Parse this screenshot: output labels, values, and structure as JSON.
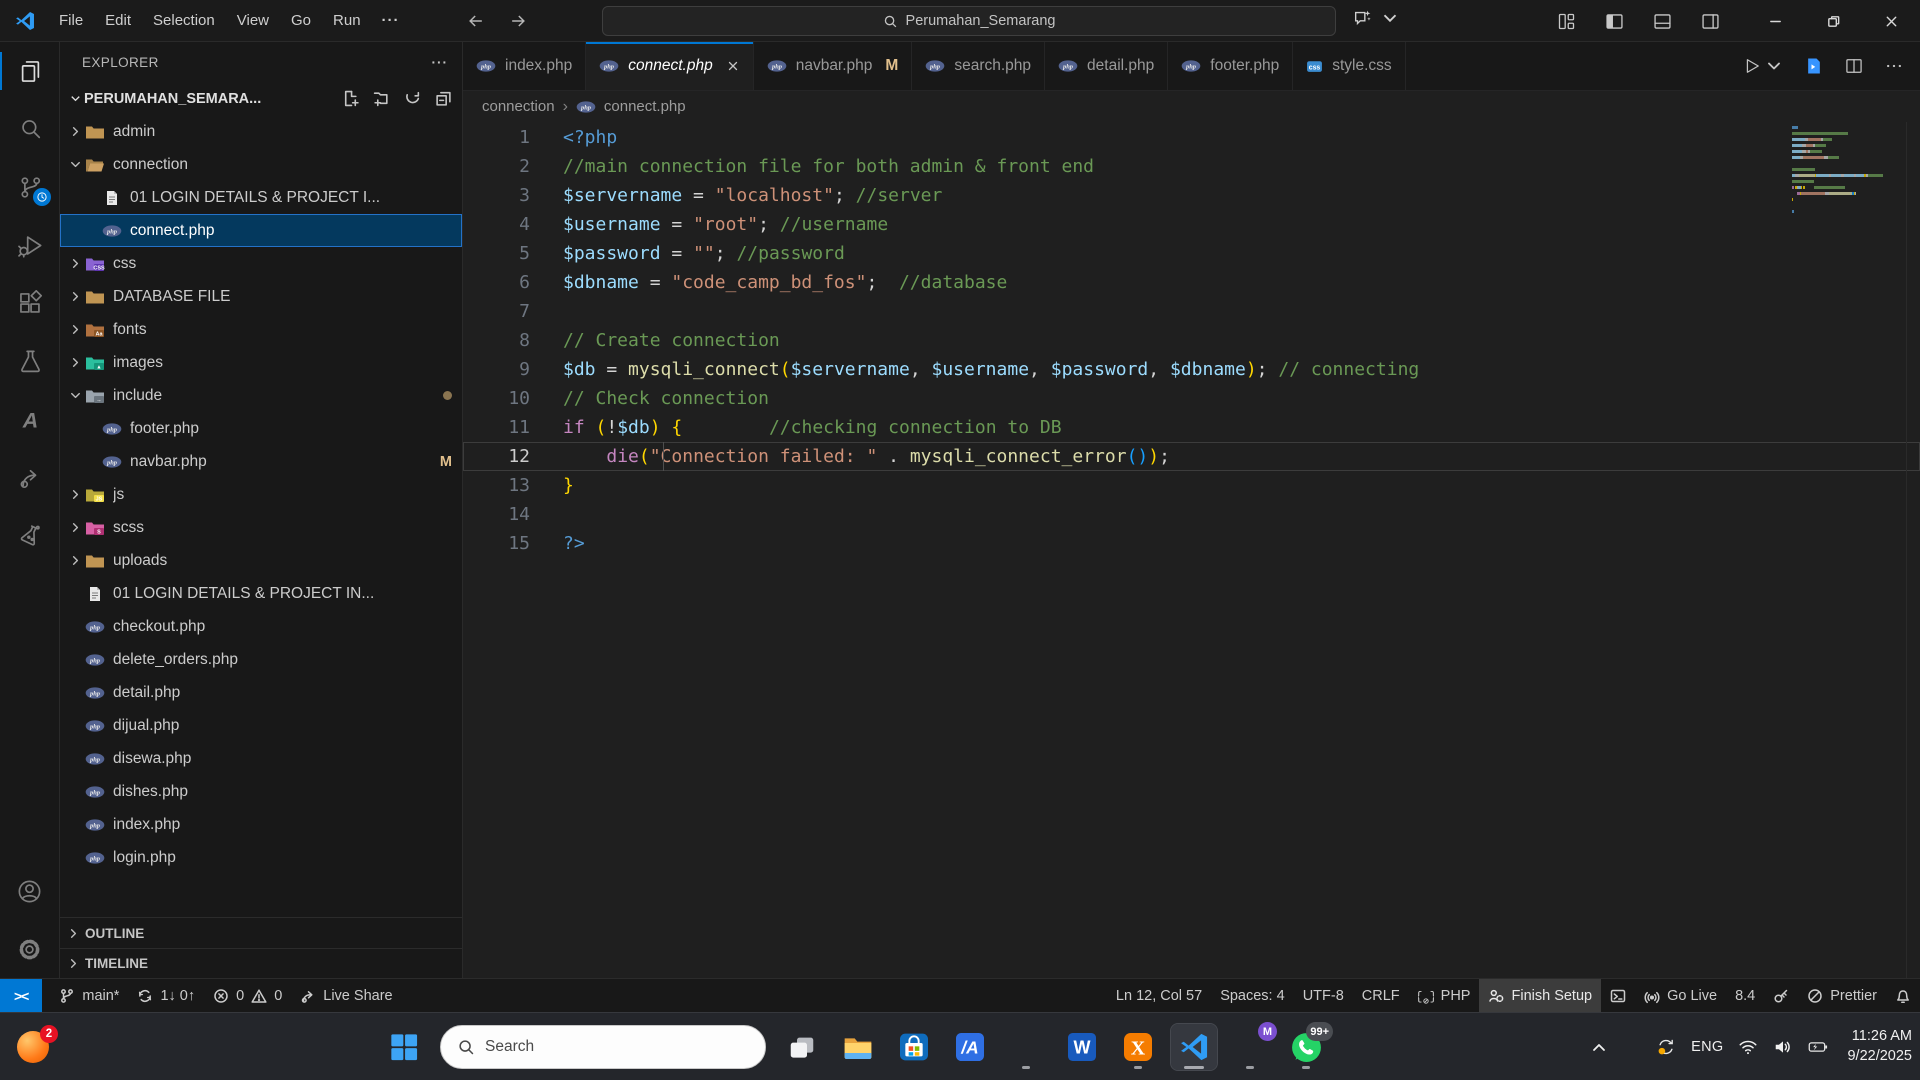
{
  "title_bar": {
    "menus": [
      "File",
      "Edit",
      "Selection",
      "View",
      "Go",
      "Run"
    ],
    "menu_more": "···",
    "search_value": "Perumahan_Semarang",
    "layout_icons": [
      "customize-layout",
      "toggle-primary-sidebar",
      "toggle-panel",
      "toggle-secondary-sidebar"
    ],
    "window_controls": [
      "minimize",
      "maximize",
      "close"
    ]
  },
  "activity_bar": {
    "top": [
      {
        "name": "explorer",
        "active": true
      },
      {
        "name": "search"
      },
      {
        "name": "source-control",
        "badge": "clock"
      },
      {
        "name": "run-debug"
      },
      {
        "name": "extensions"
      },
      {
        "name": "testing"
      },
      {
        "name": "azure"
      },
      {
        "name": "live-share"
      },
      {
        "name": "lab"
      }
    ],
    "bottom": [
      {
        "name": "accounts"
      },
      {
        "name": "settings"
      }
    ]
  },
  "explorer": {
    "title": "EXPLORER",
    "more": "···",
    "project": "PERUMAHAN_SEMARA...",
    "actions": [
      "new-file",
      "new-folder",
      "refresh",
      "collapse-all"
    ],
    "items": [
      {
        "label": "admin",
        "icon": "folder",
        "chev": "right",
        "indent": 1
      },
      {
        "label": "connection",
        "icon": "folder-open",
        "chev": "down",
        "indent": 1
      },
      {
        "label": "01 LOGIN DETAILS & PROJECT I...",
        "icon": "doc",
        "indent": 2
      },
      {
        "label": "connect.php",
        "icon": "php",
        "indent": 2,
        "selected": true
      },
      {
        "label": "css",
        "icon": "folder-css",
        "chev": "right",
        "indent": 1
      },
      {
        "label": "DATABASE FILE",
        "icon": "folder",
        "chev": "right",
        "indent": 1
      },
      {
        "label": "fonts",
        "icon": "folder-fonts",
        "chev": "right",
        "indent": 1
      },
      {
        "label": "images",
        "icon": "folder-images",
        "chev": "right",
        "indent": 1
      },
      {
        "label": "include",
        "icon": "folder-include",
        "chev": "down",
        "indent": 1,
        "dot": true
      },
      {
        "label": "footer.php",
        "icon": "php",
        "indent": 2
      },
      {
        "label": "navbar.php",
        "icon": "php",
        "indent": 2,
        "badge": "M"
      },
      {
        "label": "js",
        "icon": "folder-js",
        "chev": "right",
        "indent": 1
      },
      {
        "label": "scss",
        "icon": "folder-scss",
        "chev": "right",
        "indent": 1
      },
      {
        "label": "uploads",
        "icon": "folder",
        "chev": "right",
        "indent": 1
      },
      {
        "label": "01 LOGIN DETAILS & PROJECT IN...",
        "icon": "doc",
        "indent": 1
      },
      {
        "label": "checkout.php",
        "icon": "php",
        "indent": 1
      },
      {
        "label": "delete_orders.php",
        "icon": "php",
        "indent": 1
      },
      {
        "label": "detail.php",
        "icon": "php",
        "indent": 1
      },
      {
        "label": "dijual.php",
        "icon": "php",
        "indent": 1
      },
      {
        "label": "disewa.php",
        "icon": "php",
        "indent": 1
      },
      {
        "label": "dishes.php",
        "icon": "php",
        "indent": 1
      },
      {
        "label": "index.php",
        "icon": "php",
        "indent": 1
      },
      {
        "label": "login.php",
        "icon": "php",
        "indent": 1
      }
    ],
    "sections": [
      "OUTLINE",
      "TIMELINE"
    ]
  },
  "tabs": {
    "items": [
      {
        "label": "index.php",
        "icon": "php"
      },
      {
        "label": "connect.php",
        "icon": "php",
        "active": true,
        "closeable": true
      },
      {
        "label": "navbar.php",
        "icon": "php",
        "badge": "M"
      },
      {
        "label": "search.php",
        "icon": "php"
      },
      {
        "label": "detail.php",
        "icon": "php"
      },
      {
        "label": "footer.php",
        "icon": "php"
      },
      {
        "label": "style.css",
        "icon": "css"
      }
    ],
    "actions": [
      "run",
      "preview-browser",
      "split-editor",
      "more-actions"
    ]
  },
  "breadcrumb": {
    "parts": [
      "connection",
      "connect.php"
    ]
  },
  "editor": {
    "lines": [
      {
        "n": "1",
        "t": [
          [
            "<?php",
            "k"
          ]
        ]
      },
      {
        "n": "2",
        "t": [
          [
            "//main connection file for both admin & front end",
            "c"
          ]
        ]
      },
      {
        "n": "3",
        "t": [
          [
            "$servername",
            "v"
          ],
          [
            " = ",
            "o"
          ],
          [
            "\"localhost\"",
            "s"
          ],
          [
            "; ",
            "o"
          ],
          [
            "//server",
            "c"
          ]
        ]
      },
      {
        "n": "4",
        "t": [
          [
            "$username",
            "v"
          ],
          [
            " = ",
            "o"
          ],
          [
            "\"root\"",
            "s"
          ],
          [
            "; ",
            "o"
          ],
          [
            "//username",
            "c"
          ]
        ]
      },
      {
        "n": "5",
        "t": [
          [
            "$password",
            "v"
          ],
          [
            " = ",
            "o"
          ],
          [
            "\"\"",
            "s"
          ],
          [
            "; ",
            "o"
          ],
          [
            "//password",
            "c"
          ]
        ]
      },
      {
        "n": "6",
        "t": [
          [
            "$dbname",
            "v"
          ],
          [
            " = ",
            "o"
          ],
          [
            "\"code_camp_bd_fos\"",
            "s"
          ],
          [
            ";  ",
            "o"
          ],
          [
            "//database",
            "c"
          ]
        ]
      },
      {
        "n": "7",
        "t": []
      },
      {
        "n": "8",
        "t": [
          [
            "// Create connection",
            "c"
          ]
        ]
      },
      {
        "n": "9",
        "t": [
          [
            "$db",
            "v"
          ],
          [
            " = ",
            "o"
          ],
          [
            "mysqli_connect",
            "f"
          ],
          [
            "(",
            "g"
          ],
          [
            "$servername",
            "v"
          ],
          [
            ", ",
            "o"
          ],
          [
            "$username",
            "v"
          ],
          [
            ", ",
            "o"
          ],
          [
            "$password",
            "v"
          ],
          [
            ", ",
            "o"
          ],
          [
            "$dbname",
            "v"
          ],
          [
            ")",
            "g"
          ],
          [
            "; ",
            "o"
          ],
          [
            "// connecting",
            "c"
          ]
        ]
      },
      {
        "n": "10",
        "t": [
          [
            "// Check connection",
            "c"
          ]
        ]
      },
      {
        "n": "11",
        "t": [
          [
            "if",
            "p"
          ],
          [
            " ",
            "o"
          ],
          [
            "(",
            "g"
          ],
          [
            "!",
            "o"
          ],
          [
            "$db",
            "v"
          ],
          [
            ")",
            "g"
          ],
          [
            " ",
            "o"
          ],
          [
            "{",
            "g"
          ],
          [
            "        ",
            "o"
          ],
          [
            "//checking connection to DB",
            "c"
          ]
        ],
        "cur": false
      },
      {
        "n": "12",
        "t": [
          [
            "    ",
            "o"
          ],
          [
            "die",
            "p"
          ],
          [
            "(",
            "g"
          ],
          [
            "\"Connection failed: \"",
            "s"
          ],
          [
            " . ",
            "o"
          ],
          [
            "mysqli_connect_error",
            "f"
          ],
          [
            "(",
            "u"
          ],
          [
            ")",
            "u"
          ],
          [
            ")",
            "g"
          ],
          [
            ";",
            "o"
          ]
        ],
        "cur": true
      },
      {
        "n": "13",
        "t": [
          [
            "}",
            "g"
          ]
        ]
      },
      {
        "n": "14",
        "t": []
      },
      {
        "n": "15",
        "t": [
          [
            "?>",
            "k"
          ]
        ]
      }
    ]
  },
  "status_bar": {
    "left": [
      {
        "icon": "remote",
        "text": "><",
        "cls": "remote",
        "name": "remote-indicator"
      },
      {
        "icon": "branch",
        "text": "main*",
        "name": "git-branch"
      },
      {
        "icon": "sync",
        "text": "1↓ 0↑",
        "name": "git-sync"
      },
      {
        "icon": "error",
        "text": "0",
        "icon2": "warn",
        "text2": "0",
        "name": "problems"
      },
      {
        "icon": "share",
        "text": "Live Share",
        "name": "live-share"
      }
    ],
    "right": [
      {
        "text": "Ln 12, Col 57",
        "name": "cursor-position"
      },
      {
        "text": "Spaces: 4",
        "name": "indentation"
      },
      {
        "text": "UTF-8",
        "name": "encoding"
      },
      {
        "text": "CRLF",
        "name": "eol"
      },
      {
        "icon": "braces",
        "text": "PHP",
        "name": "language-mode"
      },
      {
        "icon": "person",
        "text": "Finish Setup",
        "cls": "hl",
        "name": "finish-setup"
      },
      {
        "icon": "terminal",
        "text": "",
        "name": "terminal"
      },
      {
        "icon": "broadcast",
        "text": "Go Live",
        "name": "go-live"
      },
      {
        "text": "8.4",
        "name": "php-version"
      },
      {
        "icon": "key",
        "text": "",
        "name": "key"
      },
      {
        "icon": "noslash",
        "text": "Prettier",
        "name": "prettier"
      },
      {
        "icon": "bell",
        "text": "",
        "name": "notifications"
      }
    ]
  },
  "taskbar": {
    "widget_badge": "2",
    "search_label": "Search",
    "items": [
      {
        "name": "start"
      },
      {
        "name": "search-pill"
      },
      {
        "name": "task-view"
      },
      {
        "name": "file-explorer"
      },
      {
        "name": "store"
      },
      {
        "name": "app-a"
      },
      {
        "name": "edge",
        "dot": true
      },
      {
        "name": "word"
      },
      {
        "name": "xampp",
        "dot": true
      },
      {
        "name": "vscode",
        "dot": true,
        "active": true
      },
      {
        "name": "chrome",
        "dot": true,
        "badge": "M",
        "badge_color": "#7b4fd0"
      },
      {
        "name": "whatsapp",
        "dot": true,
        "badge": "99+",
        "badge_color": "#4a4d52"
      }
    ],
    "tray": {
      "lang": "ENG",
      "time": "11:26 AM",
      "date": "9/22/2025",
      "icons": [
        "chevron-up",
        "onedrive-sync",
        "wifi",
        "volume",
        "battery"
      ]
    }
  }
}
